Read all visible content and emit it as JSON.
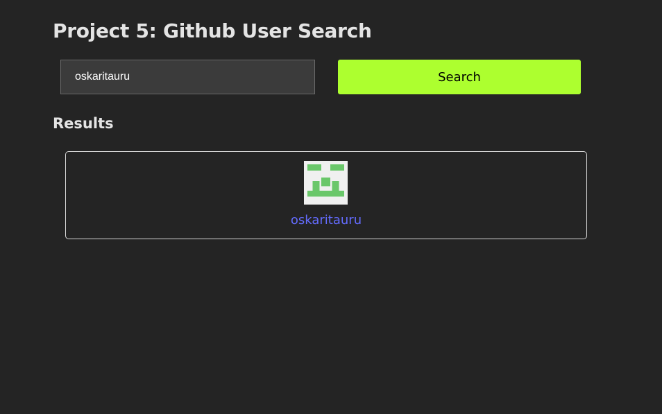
{
  "header": {
    "title": "Project 5: Github User Search"
  },
  "search": {
    "value": "oskaritauru",
    "button_label": "Search"
  },
  "results": {
    "heading": "Results",
    "items": [
      {
        "username": "oskaritauru",
        "avatar": "identicon-green"
      }
    ]
  },
  "colors": {
    "background": "#242424",
    "button": "#adff2f",
    "link": "#646cff",
    "avatar_fg": "#6ac76a",
    "avatar_bg": "#f0f0f0"
  }
}
